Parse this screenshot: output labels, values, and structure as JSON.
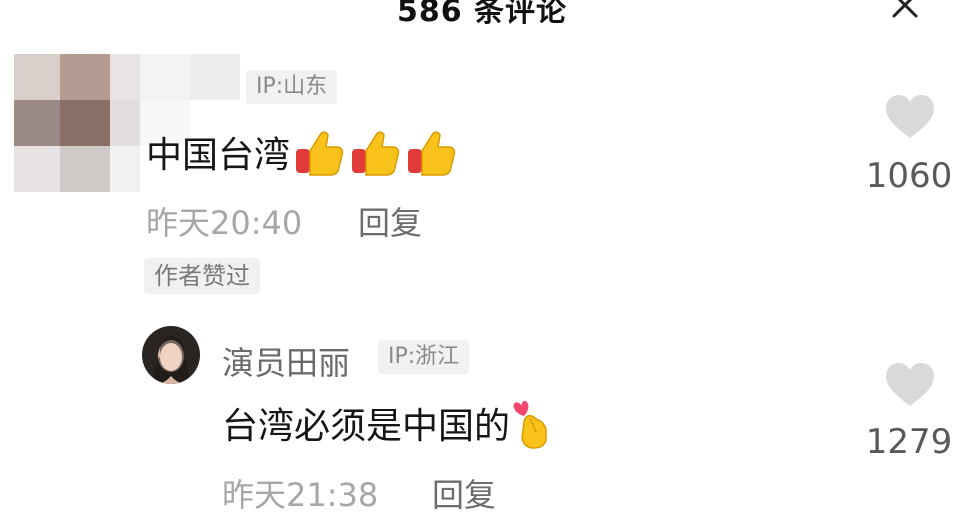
{
  "header": {
    "title": "586 条评论"
  },
  "comments": [
    {
      "ip": "IP:山东",
      "text": "中国台湾",
      "emojis": [
        "thumbs-up-icon",
        "thumbs-up-icon",
        "thumbs-up-icon"
      ],
      "time": "昨天20:40",
      "reply_label": "回复",
      "author_liked": "作者赞过",
      "likes": "1060"
    }
  ],
  "replies": [
    {
      "name": "演员田丽",
      "ip": "IP:浙江",
      "text": "台湾必须是中国的",
      "emoji": "finger-heart-icon",
      "time": "昨天21:38",
      "reply_label": "回复",
      "likes": "1279"
    }
  ],
  "colors": {
    "heart": "#d9d9d9",
    "meta_text": "#a7a7a7",
    "badge_bg": "#f1f1f1",
    "thumb_yellow": "#f9c21a",
    "thumb_red": "#e23b3b"
  }
}
